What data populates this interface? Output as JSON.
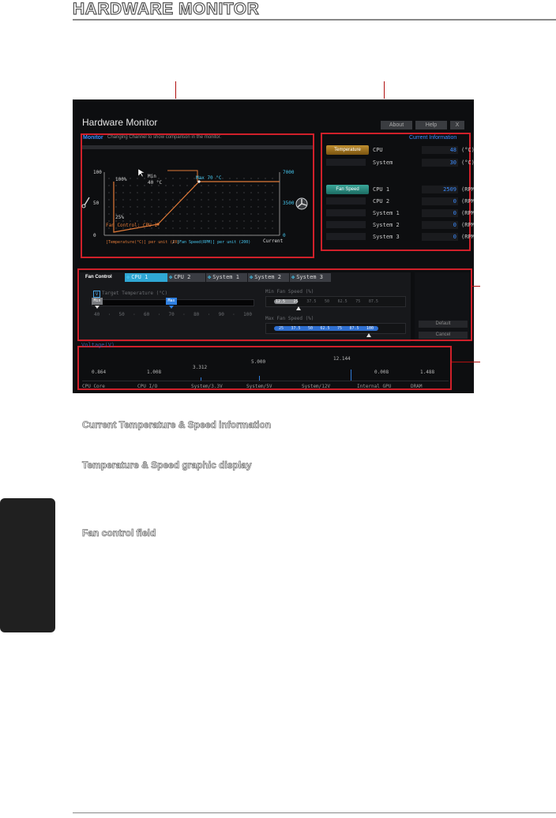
{
  "document": {
    "title": "HARDWARE MONITOR",
    "captions": [
      "Current Temperature & Speed information",
      "Temperature & Speed graphic display",
      "Fan control field"
    ]
  },
  "app": {
    "title": "Hardware Monitor",
    "buttons": {
      "about": "About",
      "help": "Help",
      "close": "X"
    }
  },
  "monitor": {
    "label": "Monitor",
    "hint": "Changing Channel to show comparison in the monitor.",
    "temp_axis": {
      "top": "100",
      "mid": "50",
      "bottom": "0"
    },
    "rpm_axis": {
      "top": "7000",
      "mid": "3500",
      "bottom": "0"
    },
    "points": {
      "percent_high": "100%",
      "min_label": "Min",
      "min_temp": "40 °C",
      "max_label": "Max 70 °C",
      "percent_low": "25%"
    },
    "fan_channel": "Fan Control: CPU 1",
    "current_label": "Current",
    "legend_temp": "[Temperature(°C)] per unit (10)",
    "legend_sep": "/",
    "legend_fan": "[Fan Speed(RPM)] per unit (200)"
  },
  "current_info": {
    "header": "Current Information",
    "temperature_tag": "Temperature",
    "fan_speed_tag": "Fan Speed",
    "temps": [
      {
        "name": "CPU",
        "value": "48",
        "unit": "(°C)"
      },
      {
        "name": "System",
        "value": "30",
        "unit": "(°C)"
      }
    ],
    "fans": [
      {
        "name": "CPU 1",
        "value": "2509",
        "unit": "(RPM)"
      },
      {
        "name": "CPU 2",
        "value": "0",
        "unit": "(RPM)"
      },
      {
        "name": "System 1",
        "value": "0",
        "unit": "(RPM)"
      },
      {
        "name": "System 2",
        "value": "0",
        "unit": "(RPM)"
      },
      {
        "name": "System 3",
        "value": "0",
        "unit": "(RPM)"
      }
    ]
  },
  "fan_control": {
    "label": "Fan Control",
    "tabs": [
      "CPU 1",
      "CPU 2",
      "System 1",
      "System 2",
      "System 3"
    ],
    "target_temp_check": "V",
    "target_temp_label": "Target Temperature (°C)",
    "min_marker": "Min",
    "max_marker": "Max",
    "temp_scale": [
      "40",
      "·",
      "50",
      "·",
      "60",
      "·",
      "70",
      "·",
      "80",
      "·",
      "90",
      "·",
      "100"
    ],
    "min_fan_label": "Min Fan Speed (%)",
    "min_fan_values": [
      "12.5",
      "25",
      "37.5",
      "50",
      "62.5",
      "75",
      "87.5"
    ],
    "max_fan_label": "Max Fan Speed (%)",
    "max_fan_values": [
      "25",
      "37.5",
      "50",
      "62.5",
      "75",
      "87.5",
      "100"
    ],
    "default_button": "Default",
    "cancel_button": "Cancel"
  },
  "voltage": {
    "label": "Voltage(V)",
    "rails": [
      {
        "name": "CPU Core",
        "value": "0.864"
      },
      {
        "name": "CPU I/O",
        "value": "1.008"
      },
      {
        "name": "System/3.3V",
        "value": "3.312"
      },
      {
        "name": "System/5V",
        "value": "5.000"
      },
      {
        "name": "System/12V",
        "value": "12.144"
      },
      {
        "name": "Internal GPU",
        "value": "0.008"
      },
      {
        "name": "DRAM",
        "value": "1.488"
      }
    ]
  },
  "colors": {
    "callout_red": "#d0202a",
    "accent_blue": "#3c8cff",
    "accent_cyan": "#46c8f0",
    "curve_orange": "#e07a38"
  }
}
